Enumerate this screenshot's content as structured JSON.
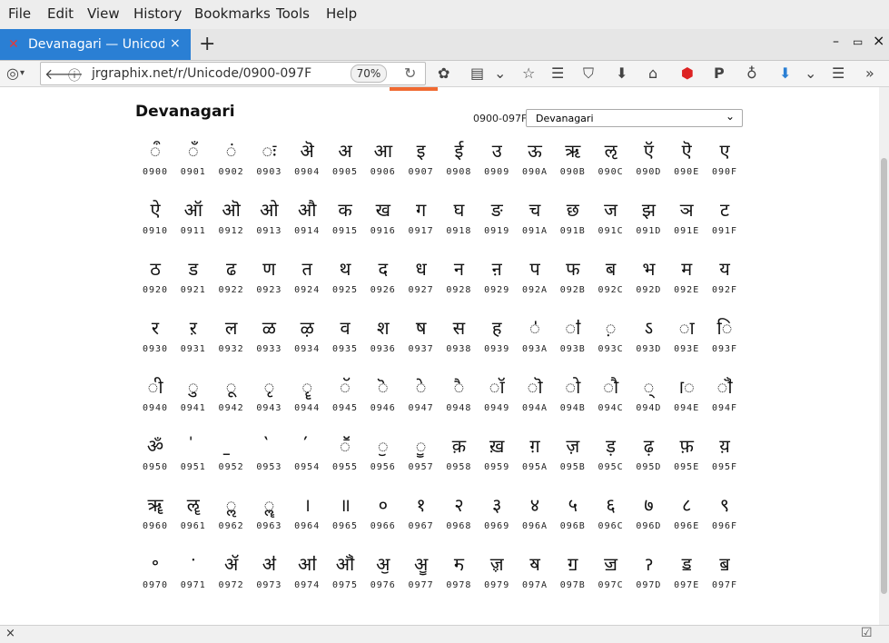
{
  "menu": [
    "File",
    "Edit",
    "View",
    "History",
    "Bookmarks",
    "Tools",
    "Help"
  ],
  "tab": {
    "title": "Devanagari — Unicode ch",
    "favicon": "x-mark-favicon",
    "close": "×",
    "new_tab": "+"
  },
  "window_controls": {
    "minimize": "–",
    "restore": "▭",
    "close": "×"
  },
  "nav": {
    "url": "jrgraphix.net/r/Unicode/0900-097F",
    "zoom": "70%"
  },
  "page": {
    "title": "Devanagari",
    "range": "0900-097F",
    "select_value": "Devanagari"
  },
  "glyph_rows": [
    [
      [
        "ऀ",
        "0900"
      ],
      [
        "ँ",
        "0901"
      ],
      [
        "ं",
        "0902"
      ],
      [
        "ः",
        "0903"
      ],
      [
        "ऄ",
        "0904"
      ],
      [
        "अ",
        "0905"
      ],
      [
        "आ",
        "0906"
      ],
      [
        "इ",
        "0907"
      ],
      [
        "ई",
        "0908"
      ],
      [
        "उ",
        "0909"
      ],
      [
        "ऊ",
        "090A"
      ],
      [
        "ऋ",
        "090B"
      ],
      [
        "ऌ",
        "090C"
      ],
      [
        "ऍ",
        "090D"
      ],
      [
        "ऎ",
        "090E"
      ],
      [
        "ए",
        "090F"
      ]
    ],
    [
      [
        "ऐ",
        "0910"
      ],
      [
        "ऑ",
        "0911"
      ],
      [
        "ऒ",
        "0912"
      ],
      [
        "ओ",
        "0913"
      ],
      [
        "औ",
        "0914"
      ],
      [
        "क",
        "0915"
      ],
      [
        "ख",
        "0916"
      ],
      [
        "ग",
        "0917"
      ],
      [
        "घ",
        "0918"
      ],
      [
        "ङ",
        "0919"
      ],
      [
        "च",
        "091A"
      ],
      [
        "छ",
        "091B"
      ],
      [
        "ज",
        "091C"
      ],
      [
        "झ",
        "091D"
      ],
      [
        "ञ",
        "091E"
      ],
      [
        "ट",
        "091F"
      ]
    ],
    [
      [
        "ठ",
        "0920"
      ],
      [
        "ड",
        "0921"
      ],
      [
        "ढ",
        "0922"
      ],
      [
        "ण",
        "0923"
      ],
      [
        "त",
        "0924"
      ],
      [
        "थ",
        "0925"
      ],
      [
        "द",
        "0926"
      ],
      [
        "ध",
        "0927"
      ],
      [
        "न",
        "0928"
      ],
      [
        "ऩ",
        "0929"
      ],
      [
        "प",
        "092A"
      ],
      [
        "फ",
        "092B"
      ],
      [
        "ब",
        "092C"
      ],
      [
        "भ",
        "092D"
      ],
      [
        "म",
        "092E"
      ],
      [
        "य",
        "092F"
      ]
    ],
    [
      [
        "र",
        "0930"
      ],
      [
        "ऱ",
        "0931"
      ],
      [
        "ल",
        "0932"
      ],
      [
        "ळ",
        "0933"
      ],
      [
        "ऴ",
        "0934"
      ],
      [
        "व",
        "0935"
      ],
      [
        "श",
        "0936"
      ],
      [
        "ष",
        "0937"
      ],
      [
        "स",
        "0938"
      ],
      [
        "ह",
        "0939"
      ],
      [
        "ऺ",
        "093A"
      ],
      [
        "ऻ",
        "093B"
      ],
      [
        "़",
        "093C"
      ],
      [
        "ऽ",
        "093D"
      ],
      [
        "ा",
        "093E"
      ],
      [
        "ि",
        "093F"
      ]
    ],
    [
      [
        "ी",
        "0940"
      ],
      [
        "ु",
        "0941"
      ],
      [
        "ू",
        "0942"
      ],
      [
        "ृ",
        "0943"
      ],
      [
        "ॄ",
        "0944"
      ],
      [
        "ॅ",
        "0945"
      ],
      [
        "ॆ",
        "0946"
      ],
      [
        "े",
        "0947"
      ],
      [
        "ै",
        "0948"
      ],
      [
        "ॉ",
        "0949"
      ],
      [
        "ॊ",
        "094A"
      ],
      [
        "ो",
        "094B"
      ],
      [
        "ौ",
        "094C"
      ],
      [
        "्",
        "094D"
      ],
      [
        "ॎ",
        "094E"
      ],
      [
        "ॏ",
        "094F"
      ]
    ],
    [
      [
        "ॐ",
        "0950"
      ],
      [
        "॑",
        "0951"
      ],
      [
        "॒",
        "0952"
      ],
      [
        "॓",
        "0953"
      ],
      [
        "॔",
        "0954"
      ],
      [
        "ॕ",
        "0955"
      ],
      [
        "ॖ",
        "0956"
      ],
      [
        "ॗ",
        "0957"
      ],
      [
        "क़",
        "0958"
      ],
      [
        "ख़",
        "0959"
      ],
      [
        "ग़",
        "095A"
      ],
      [
        "ज़",
        "095B"
      ],
      [
        "ड़",
        "095C"
      ],
      [
        "ढ़",
        "095D"
      ],
      [
        "फ़",
        "095E"
      ],
      [
        "य़",
        "095F"
      ]
    ],
    [
      [
        "ॠ",
        "0960"
      ],
      [
        "ॡ",
        "0961"
      ],
      [
        "ॢ",
        "0962"
      ],
      [
        "ॣ",
        "0963"
      ],
      [
        "।",
        "0964"
      ],
      [
        "॥",
        "0965"
      ],
      [
        "०",
        "0966"
      ],
      [
        "१",
        "0967"
      ],
      [
        "२",
        "0968"
      ],
      [
        "३",
        "0969"
      ],
      [
        "४",
        "096A"
      ],
      [
        "५",
        "096B"
      ],
      [
        "६",
        "096C"
      ],
      [
        "७",
        "096D"
      ],
      [
        "८",
        "096E"
      ],
      [
        "९",
        "096F"
      ]
    ],
    [
      [
        "॰",
        "0970"
      ],
      [
        "ॱ",
        "0971"
      ],
      [
        "ॲ",
        "0972"
      ],
      [
        "ॳ",
        "0973"
      ],
      [
        "ॴ",
        "0974"
      ],
      [
        "ॵ",
        "0975"
      ],
      [
        "ॶ",
        "0976"
      ],
      [
        "ॷ",
        "0977"
      ],
      [
        "ॸ",
        "0978"
      ],
      [
        "ॹ",
        "0979"
      ],
      [
        "ॺ",
        "097A"
      ],
      [
        "ॻ",
        "097B"
      ],
      [
        "ॼ",
        "097C"
      ],
      [
        "ॽ",
        "097D"
      ],
      [
        "ॾ",
        "097E"
      ],
      [
        "ॿ",
        "097F"
      ]
    ]
  ]
}
